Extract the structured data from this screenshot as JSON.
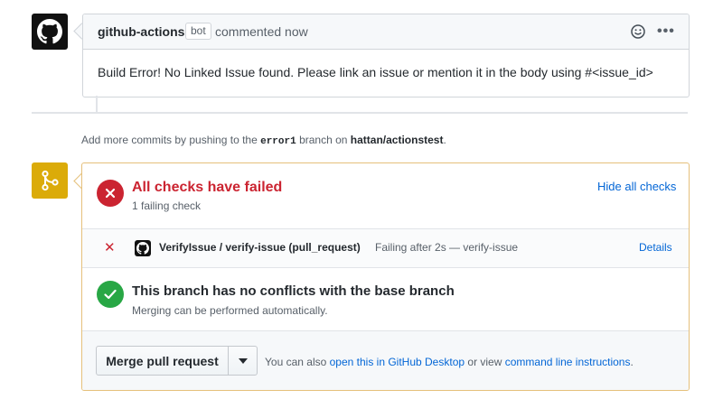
{
  "comment": {
    "author": "github-actions",
    "badge": "bot",
    "time": "commented now",
    "body": "Build Error! No Linked Issue found. Please link an issue or mention it in the body using #<issue_id>",
    "more": "•••"
  },
  "push_hint": {
    "prefix": "Add more commits by pushing to the",
    "branch": "error1",
    "middle": "branch on",
    "repo": "hattan/actionstest",
    "suffix": "."
  },
  "checks": {
    "title": "All checks have failed",
    "subtitle": "1 failing check",
    "toggle": "Hide all checks",
    "rows": [
      {
        "name": "VerifyIssue / verify-issue (pull_request)",
        "status": "Failing after 2s — verify-issue",
        "details": "Details",
        "state": "failure",
        "mark": "✕"
      }
    ]
  },
  "conflicts": {
    "title": "This branch has no conflicts with the base branch",
    "subtitle": "Merging can be performed automatically."
  },
  "merge": {
    "button": "Merge pull request",
    "also_prefix": "You can also",
    "desktop_link": "open this in GitHub Desktop",
    "or_view": "or view",
    "cli_link": "command line instructions",
    "end": "."
  },
  "colors": {
    "failure": "#cb2431",
    "success": "#28a745",
    "warning_icon": "#dbab09",
    "link": "#0366d6"
  },
  "icons": [
    "github-logo-icon",
    "smiley-icon",
    "kebab-icon",
    "git-merge-icon",
    "x-icon",
    "check-icon",
    "caret-down-icon"
  ]
}
